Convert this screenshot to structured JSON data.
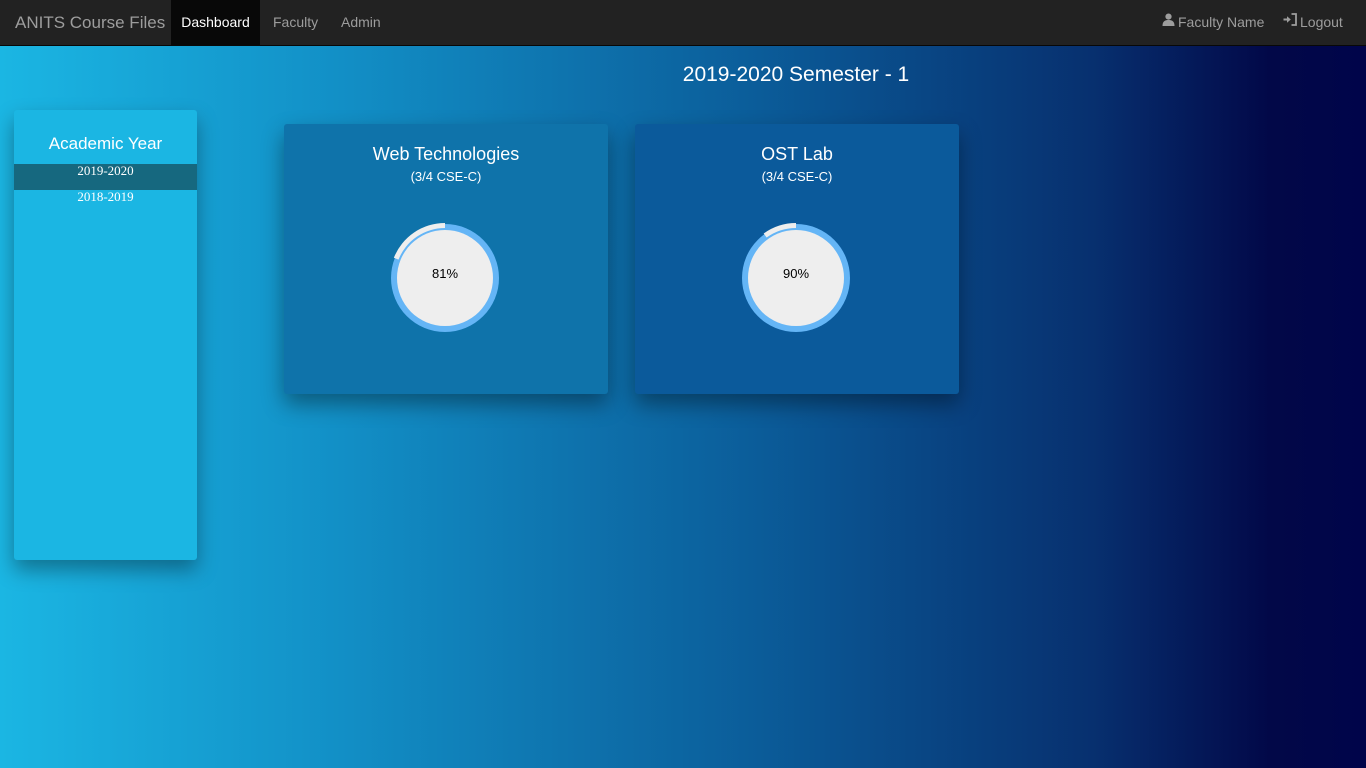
{
  "navbar": {
    "brand": "ANITS Course Files",
    "items": [
      {
        "label": "Dashboard",
        "active": true
      },
      {
        "label": "Faculty",
        "active": false
      },
      {
        "label": "Admin",
        "active": false
      }
    ],
    "user": {
      "label": "Faculty Name",
      "icon": "user-icon"
    },
    "logout": {
      "label": "Logout",
      "icon": "logout-icon"
    }
  },
  "main": {
    "title": "2019-2020 Semester - 1"
  },
  "sidebar": {
    "title": "Academic Year",
    "items": [
      {
        "label": "2019-2020",
        "active": true
      },
      {
        "label": "2018-2019",
        "active": false
      }
    ]
  },
  "courses": [
    {
      "title": "Web Technologies",
      "section": "(3/4 CSE-C)",
      "progress": 81,
      "progress_label": "81%"
    },
    {
      "title": "OST Lab",
      "section": "(3/4 CSE-C)",
      "progress": 90,
      "progress_label": "90%"
    }
  ],
  "colors": {
    "ring_progress": "#64b5f6",
    "ring_background": "#eeeeee",
    "nav_background": "#222222",
    "sidebar_background": "#1bb6e3",
    "sidebar_active": "#16687f"
  }
}
